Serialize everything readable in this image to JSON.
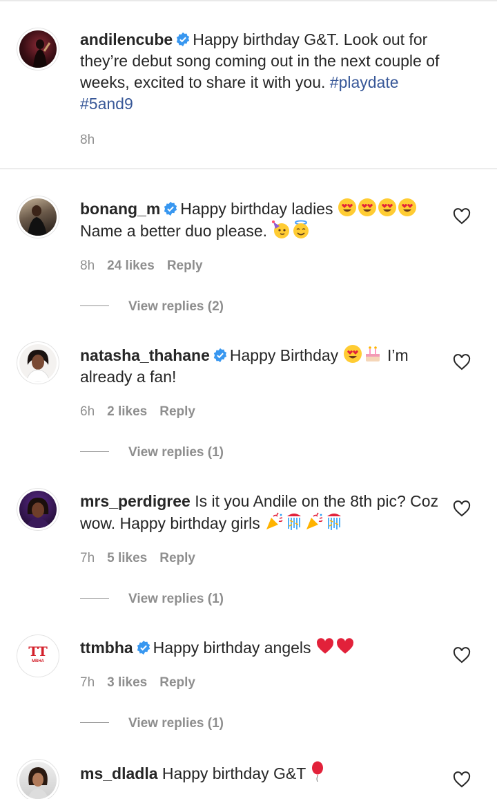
{
  "caption": {
    "username": "andilencube",
    "verified": true,
    "text": "Happy birthday G&T. Look out for they’re debut song coming out in the next couple of weeks, excited to share it with you.",
    "hashtags": [
      "#playdate",
      "#5and9"
    ],
    "time": "8h"
  },
  "comments": [
    {
      "username": "bonang_m",
      "verified": true,
      "text_before": "Happy birthday ladies",
      "emojis_a": [
        "smiling-face-with-heart-eyes",
        "smiling-face-with-heart-eyes",
        "smiling-face-with-heart-eyes",
        "smiling-face-with-heart-eyes"
      ],
      "text_after": "Name a better duo please.",
      "emojis_b": [
        "partying-face",
        "smiling-face-with-halo"
      ],
      "time": "8h",
      "likes": "24 likes",
      "reply": "Reply",
      "view_replies": "View replies (2)"
    },
    {
      "username": "natasha_thahane",
      "verified": true,
      "text_before": "Happy Birthday",
      "emojis_a": [
        "smiling-face-with-heart-eyes",
        "birthday-cake"
      ],
      "text_after": "I’m already a fan!",
      "time": "6h",
      "likes": "2 likes",
      "reply": "Reply",
      "view_replies": "View replies (1)"
    },
    {
      "username": "mrs_perdigree",
      "verified": false,
      "text_before": "Is it you Andile on the 8th pic? Coz wow. Happy birthday girls",
      "emojis_a": [
        "party-popper",
        "confetti-ball",
        "party-popper",
        "confetti-ball"
      ],
      "time": "7h",
      "likes": "5 likes",
      "reply": "Reply",
      "view_replies": "View replies (1)"
    },
    {
      "username": "ttmbha",
      "verified": true,
      "text_before": "Happy birthday angels",
      "emojis_a": [
        "red-heart",
        "red-heart"
      ],
      "time": "7h",
      "likes": "3 likes",
      "reply": "Reply",
      "view_replies": "View replies (1)",
      "avatar_logo_text": "TT",
      "avatar_logo_sub": "MBHA"
    },
    {
      "username": "ms_dladla",
      "verified": false,
      "text_before": "Happy birthday G&T",
      "emojis_a": [
        "balloon"
      ]
    }
  ],
  "colors": {
    "text": "#262626",
    "muted": "#8e8e8e",
    "hashtag": "#385898",
    "verified": "#3897f0",
    "divider": "#ececec"
  }
}
